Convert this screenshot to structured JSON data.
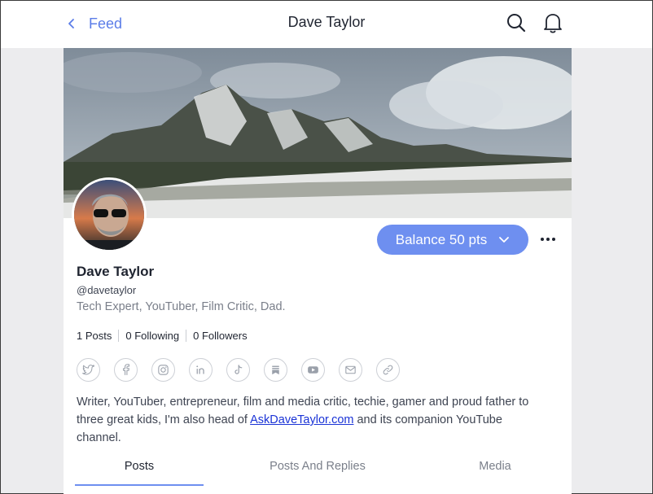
{
  "header": {
    "back_label": "Feed",
    "title": "Dave Taylor",
    "back_icon": "chevron-left-icon",
    "search_icon": "search-icon",
    "notifications_icon": "bell-icon"
  },
  "profile": {
    "name": "Dave Taylor",
    "handle": "@davetaylor",
    "tagline": "Tech Expert, YouTuber, Film Critic, Dad.",
    "balance_label": "Balance 50 pts",
    "stats": {
      "posts": "1 Posts",
      "following": "0 Following",
      "followers": "0 Followers"
    },
    "socials": [
      "twitter-icon",
      "facebook-icon",
      "instagram-icon",
      "linkedin-icon",
      "tiktok-icon",
      "substack-icon",
      "youtube-icon",
      "email-icon",
      "link-icon"
    ],
    "bio": {
      "before_link": "Writer, YouTuber, entrepreneur, film and media critic, techie, gamer and proud father to three great kids, I'm also head of ",
      "link_text": "AskDaveTaylor.com",
      "after_link": " and its companion YouTube channel."
    }
  },
  "tabs": [
    {
      "label": "Posts",
      "active": true
    },
    {
      "label": "Posts And Replies",
      "active": false
    },
    {
      "label": "Media",
      "active": false
    }
  ],
  "colors": {
    "accent": "#6e8ff0",
    "link": "#1a33d6",
    "muted_text": "#7a7f8a"
  }
}
